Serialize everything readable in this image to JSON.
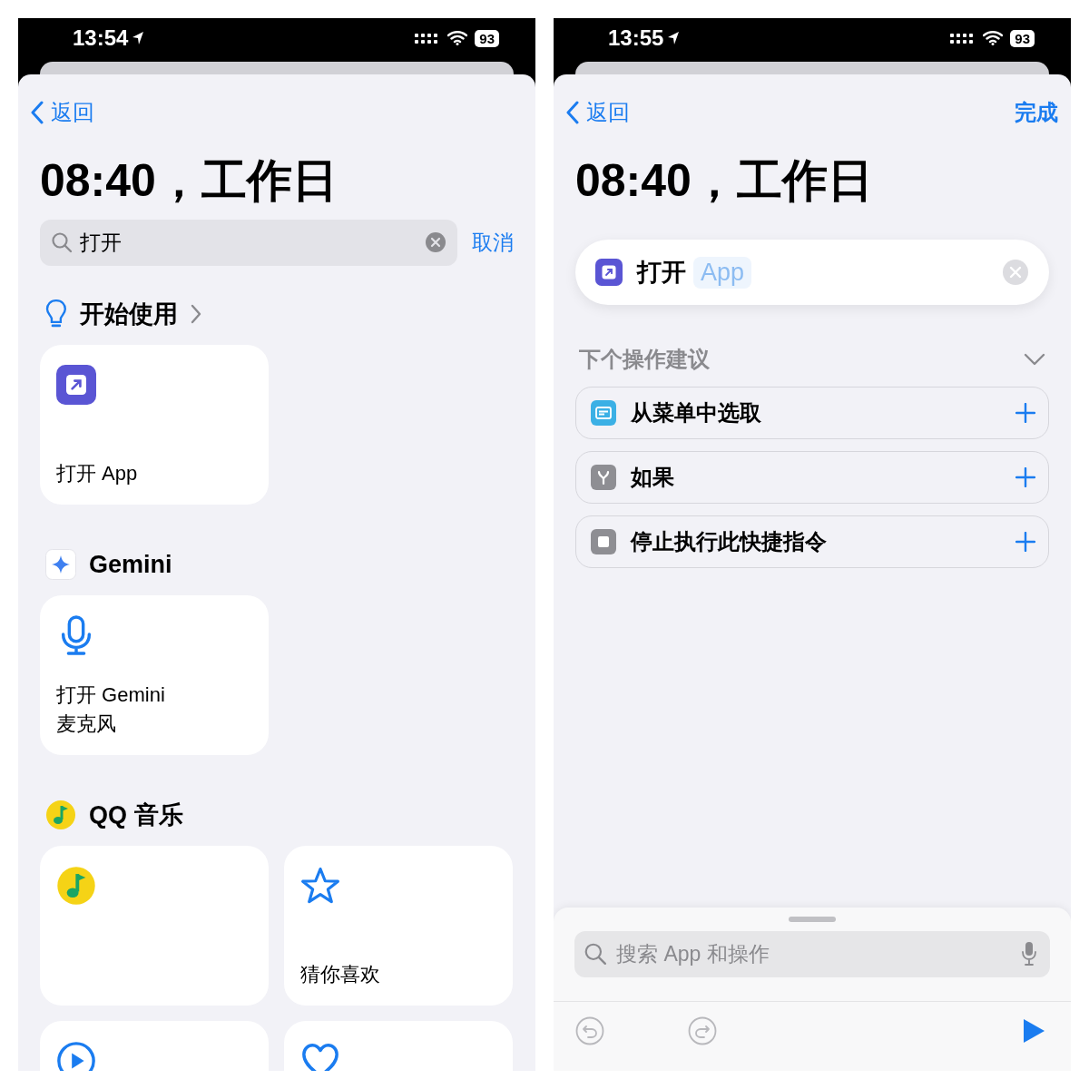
{
  "screens": [
    {
      "kind": "picker",
      "status_bar": {
        "time": "13:54",
        "battery": "93"
      },
      "back": "返回",
      "title": "08:40，工作日",
      "search": {
        "value": "打开",
        "cancel": "取消"
      },
      "sections": [
        {
          "kind": "tips",
          "title": "开始使用",
          "has_more": true,
          "tiles": [
            {
              "kind": "open_app",
              "label": "打开 App"
            }
          ]
        },
        {
          "kind": "gemini",
          "title": "Gemini",
          "has_more": false,
          "tiles": [
            {
              "kind": "mic",
              "label": "打开 Gemini\n麦克风"
            }
          ]
        },
        {
          "kind": "qq_music",
          "title": "QQ 音乐",
          "has_more": false,
          "tiles": [
            {
              "kind": "qq_music"
            },
            {
              "kind": "star",
              "label": "猜你喜欢"
            },
            {
              "kind": "play"
            },
            {
              "kind": "heart"
            }
          ]
        }
      ]
    },
    {
      "kind": "editor",
      "status_bar": {
        "time": "13:55",
        "battery": "93"
      },
      "back": "返回",
      "done": "完成",
      "title": "08:40，工作日",
      "action": {
        "kind": "open_app",
        "verb": "打开",
        "parameter": "App"
      },
      "suggestions": {
        "title": "下个操作建议",
        "expanded": true,
        "items": [
          {
            "kind": "menu",
            "label": "从菜单中选取"
          },
          {
            "kind": "if",
            "label": "如果"
          },
          {
            "kind": "stop",
            "label": "停止执行此快捷指令"
          }
        ]
      },
      "bottom_search": {
        "placeholder": "搜索 App 和操作"
      }
    }
  ]
}
